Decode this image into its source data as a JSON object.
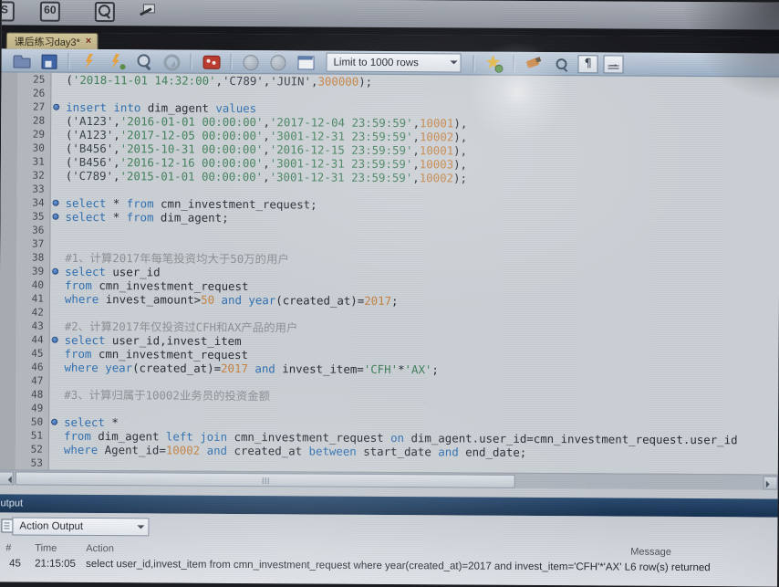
{
  "window": {
    "tab_title": "课后练习day3*",
    "close_label": "×"
  },
  "taskbar_icons": [
    {
      "name": "app-s-icon",
      "kind": "s",
      "label": "S"
    },
    {
      "name": "timer-60-icon",
      "kind": "dial",
      "label": "60"
    },
    {
      "name": "search-files-icon",
      "kind": "find"
    },
    {
      "name": "pen-icon",
      "kind": "pen"
    }
  ],
  "toolbar": {
    "items": [
      {
        "name": "open-file-icon",
        "kind": "folder"
      },
      {
        "name": "save-icon",
        "kind": "save"
      },
      {
        "name": "separator",
        "kind": "sep"
      },
      {
        "name": "execute-query-icon",
        "kind": "bolt"
      },
      {
        "name": "execute-all-icon",
        "kind": "bolt2"
      },
      {
        "name": "find-icon",
        "kind": "mag"
      },
      {
        "name": "refresh-icon",
        "kind": "refresh"
      },
      {
        "name": "separator",
        "kind": "sep"
      },
      {
        "name": "stop-query-icon",
        "kind": "stop"
      },
      {
        "name": "separator",
        "kind": "sep"
      },
      {
        "name": "back-icon",
        "kind": "circle"
      },
      {
        "name": "forward-icon",
        "kind": "circle"
      },
      {
        "name": "table-view-icon",
        "kind": "grid"
      },
      {
        "name": "row-limit-dropdown",
        "kind": "dropdown",
        "label": "Limit to 1000 rows"
      },
      {
        "name": "separator",
        "kind": "sep"
      },
      {
        "name": "favorites-icon",
        "kind": "star"
      },
      {
        "name": "separator",
        "kind": "sep"
      },
      {
        "name": "format-code-icon",
        "kind": "brush"
      },
      {
        "name": "zoom-icon",
        "kind": "magsm"
      },
      {
        "name": "pilcrow-icon",
        "kind": "pilcrow"
      },
      {
        "name": "indent-icon",
        "kind": "indent"
      }
    ]
  },
  "colors": {
    "keyword": "#2e6fb0",
    "plain": "#272c32",
    "string": "#3c424a",
    "date_string": "#41805a",
    "number": "#c5803f",
    "comment": "#8e9095"
  },
  "editor": {
    "lines": [
      {
        "n": 25,
        "dot": false,
        "seg": [
          [
            "p",
            "("
          ],
          [
            "d",
            "'2018-11-01 14:32:00'"
          ],
          [
            "p",
            ","
          ],
          [
            "s",
            "'C789'"
          ],
          [
            "p",
            ","
          ],
          [
            "s",
            "'JUIN'"
          ],
          [
            "p",
            ","
          ],
          [
            "n",
            "300000"
          ],
          [
            "p",
            ");"
          ]
        ]
      },
      {
        "n": 26,
        "dot": false,
        "seg": []
      },
      {
        "n": 27,
        "dot": true,
        "seg": [
          [
            "k",
            "insert"
          ],
          [
            "p",
            " "
          ],
          [
            "k",
            "into"
          ],
          [
            "p",
            " dim_agent "
          ],
          [
            "k",
            "values"
          ]
        ]
      },
      {
        "n": 28,
        "dot": false,
        "seg": [
          [
            "p",
            "("
          ],
          [
            "s",
            "'A123'"
          ],
          [
            "p",
            ","
          ],
          [
            "d",
            "'2016-01-01 00:00:00'"
          ],
          [
            "p",
            ","
          ],
          [
            "d",
            "'2017-12-04 23:59:59'"
          ],
          [
            "p",
            ","
          ],
          [
            "n",
            "10001"
          ],
          [
            "p",
            "),"
          ]
        ]
      },
      {
        "n": 29,
        "dot": false,
        "seg": [
          [
            "p",
            "("
          ],
          [
            "s",
            "'A123'"
          ],
          [
            "p",
            ","
          ],
          [
            "d",
            "'2017-12-05 00:00:00'"
          ],
          [
            "p",
            ","
          ],
          [
            "d",
            "'3001-12-31 23:59:59'"
          ],
          [
            "p",
            ","
          ],
          [
            "n",
            "10002"
          ],
          [
            "p",
            "),"
          ]
        ]
      },
      {
        "n": 30,
        "dot": false,
        "seg": [
          [
            "p",
            "("
          ],
          [
            "s",
            "'B456'"
          ],
          [
            "p",
            ","
          ],
          [
            "d",
            "'2015-10-31 00:00:00'"
          ],
          [
            "p",
            ","
          ],
          [
            "d",
            "'2016-12-15 23:59:59'"
          ],
          [
            "p",
            ","
          ],
          [
            "n",
            "10001"
          ],
          [
            "p",
            "),"
          ]
        ]
      },
      {
        "n": 31,
        "dot": false,
        "seg": [
          [
            "p",
            "("
          ],
          [
            "s",
            "'B456'"
          ],
          [
            "p",
            ","
          ],
          [
            "d",
            "'2016-12-16 00:00:00'"
          ],
          [
            "p",
            ","
          ],
          [
            "d",
            "'3001-12-31 23:59:59'"
          ],
          [
            "p",
            ","
          ],
          [
            "n",
            "10003"
          ],
          [
            "p",
            "),"
          ]
        ]
      },
      {
        "n": 32,
        "dot": false,
        "seg": [
          [
            "p",
            "("
          ],
          [
            "s",
            "'C789'"
          ],
          [
            "p",
            ","
          ],
          [
            "d",
            "'2015-01-01 00:00:00'"
          ],
          [
            "p",
            ","
          ],
          [
            "d",
            "'3001-12-31 23:59:59'"
          ],
          [
            "p",
            ","
          ],
          [
            "n",
            "10002"
          ],
          [
            "p",
            ");"
          ]
        ]
      },
      {
        "n": 33,
        "dot": false,
        "seg": []
      },
      {
        "n": 34,
        "dot": true,
        "seg": [
          [
            "k",
            "select"
          ],
          [
            "p",
            " * "
          ],
          [
            "k",
            "from"
          ],
          [
            "p",
            " cmn_investment_request;"
          ]
        ]
      },
      {
        "n": 35,
        "dot": true,
        "seg": [
          [
            "k",
            "select"
          ],
          [
            "p",
            " * "
          ],
          [
            "k",
            "from"
          ],
          [
            "p",
            " dim_agent;"
          ]
        ]
      },
      {
        "n": 36,
        "dot": false,
        "seg": []
      },
      {
        "n": 37,
        "dot": false,
        "seg": []
      },
      {
        "n": 38,
        "dot": false,
        "seg": [
          [
            "c",
            "#1、计算2017年每笔投资均大于50万的用户"
          ]
        ]
      },
      {
        "n": 39,
        "dot": true,
        "seg": [
          [
            "k",
            "select"
          ],
          [
            "p",
            " user_id"
          ]
        ]
      },
      {
        "n": 40,
        "dot": false,
        "seg": [
          [
            "k",
            "from"
          ],
          [
            "p",
            " cmn_investment_request"
          ]
        ]
      },
      {
        "n": 41,
        "dot": false,
        "seg": [
          [
            "k",
            "where"
          ],
          [
            "p",
            " invest_amount>"
          ],
          [
            "n",
            "50"
          ],
          [
            "p",
            " "
          ],
          [
            "k",
            "and"
          ],
          [
            "p",
            " "
          ],
          [
            "k",
            "year"
          ],
          [
            "p",
            "(created_at)="
          ],
          [
            "n",
            "2017"
          ],
          [
            "p",
            ";"
          ]
        ]
      },
      {
        "n": 42,
        "dot": false,
        "seg": []
      },
      {
        "n": 43,
        "dot": false,
        "seg": [
          [
            "c",
            "#2、计算2017年仅投资过CFH和AX产品的用户"
          ]
        ]
      },
      {
        "n": 44,
        "dot": true,
        "seg": [
          [
            "k",
            "select"
          ],
          [
            "p",
            " user_id,invest_item"
          ]
        ]
      },
      {
        "n": 45,
        "dot": false,
        "seg": [
          [
            "k",
            "from"
          ],
          [
            "p",
            " cmn_investment_request"
          ]
        ]
      },
      {
        "n": 46,
        "dot": false,
        "seg": [
          [
            "k",
            "where"
          ],
          [
            "p",
            " "
          ],
          [
            "k",
            "year"
          ],
          [
            "p",
            "(created_at)="
          ],
          [
            "n",
            "2017"
          ],
          [
            "p",
            " "
          ],
          [
            "k",
            "and"
          ],
          [
            "p",
            " invest_item="
          ],
          [
            "d",
            "'CFH'"
          ],
          [
            "p",
            "*"
          ],
          [
            "d",
            "'AX'"
          ],
          [
            "p",
            ";"
          ]
        ]
      },
      {
        "n": 47,
        "dot": false,
        "seg": []
      },
      {
        "n": 48,
        "dot": false,
        "seg": [
          [
            "c",
            "#3、计算归属于10002业务员的投资金额"
          ]
        ]
      },
      {
        "n": 49,
        "dot": false,
        "seg": []
      },
      {
        "n": 50,
        "dot": true,
        "seg": [
          [
            "k",
            "select"
          ],
          [
            "p",
            " *"
          ]
        ]
      },
      {
        "n": 51,
        "dot": false,
        "seg": [
          [
            "k",
            "from"
          ],
          [
            "p",
            " dim_agent "
          ],
          [
            "k",
            "left join"
          ],
          [
            "p",
            " cmn_investment_request "
          ],
          [
            "k",
            "on"
          ],
          [
            "p",
            " dim_agent.user_id=cmn_investment_request.user_id"
          ]
        ]
      },
      {
        "n": 52,
        "dot": false,
        "seg": [
          [
            "k",
            "where"
          ],
          [
            "p",
            " Agent_id="
          ],
          [
            "n",
            "10002"
          ],
          [
            "p",
            " "
          ],
          [
            "k",
            "and"
          ],
          [
            "p",
            " created_at "
          ],
          [
            "k",
            "between"
          ],
          [
            "p",
            " start_date "
          ],
          [
            "k",
            "and"
          ],
          [
            "p",
            " end_date;"
          ]
        ]
      },
      {
        "n": 53,
        "dot": false,
        "seg": []
      }
    ]
  },
  "output": {
    "title": "utput",
    "dropdown_label": "Action Output",
    "columns": [
      "#",
      "Time",
      "Action",
      "Message"
    ],
    "rows": [
      {
        "num": "45",
        "time": "21:15:05",
        "action": "select user_id,invest_item from cmn_investment_request where year(created_at)=2017 and invest_item='CFH'*'AX' LI...",
        "message": "6 row(s) returned"
      }
    ]
  }
}
